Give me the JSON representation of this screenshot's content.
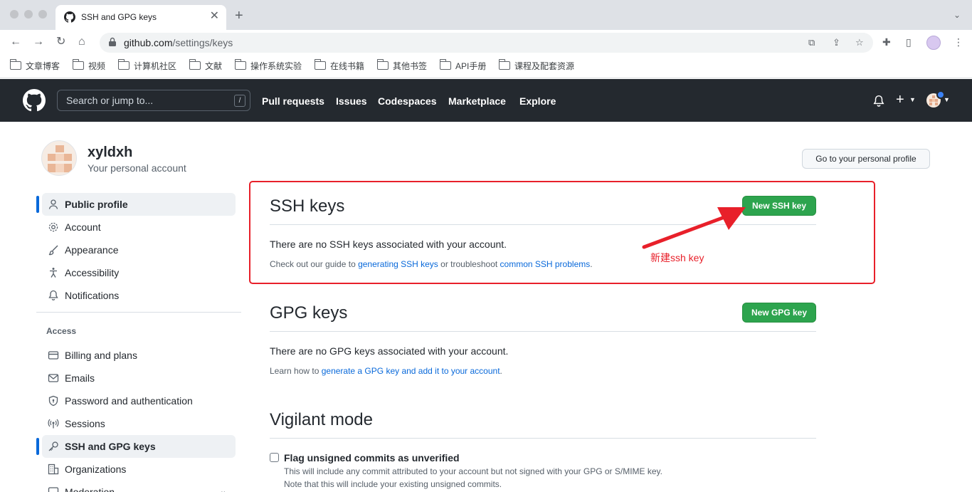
{
  "browser": {
    "tab_title": "SSH and GPG keys",
    "url_host": "github.com",
    "url_path": "/settings/keys",
    "bookmarks": [
      "文章博客",
      "视频",
      "计算机社区",
      "文献",
      "操作系统实验",
      "在线书籍",
      "其他书签",
      "API手册",
      "课程及配套资源"
    ]
  },
  "gh_header": {
    "search_placeholder": "Search or jump to...",
    "slash_key": "/",
    "nav": [
      "Pull requests",
      "Issues",
      "Codespaces",
      "Marketplace",
      "Explore"
    ]
  },
  "profile": {
    "username": "xyldxh",
    "subtitle": "Your personal account",
    "go_profile_label": "Go to your personal profile"
  },
  "sidebar": {
    "top_items": [
      {
        "label": "Public profile",
        "icon": "person-icon",
        "active": true
      },
      {
        "label": "Account",
        "icon": "gear-icon"
      },
      {
        "label": "Appearance",
        "icon": "paintbrush-icon"
      },
      {
        "label": "Accessibility",
        "icon": "accessibility-icon"
      },
      {
        "label": "Notifications",
        "icon": "bell-icon"
      }
    ],
    "access_heading": "Access",
    "access_items": [
      {
        "label": "Billing and plans",
        "icon": "credit-card-icon"
      },
      {
        "label": "Emails",
        "icon": "mail-icon"
      },
      {
        "label": "Password and authentication",
        "icon": "shield-lock-icon"
      },
      {
        "label": "Sessions",
        "icon": "broadcast-icon"
      },
      {
        "label": "SSH and GPG keys",
        "icon": "key-icon",
        "active": true
      },
      {
        "label": "Organizations",
        "icon": "organization-icon"
      },
      {
        "label": "Moderation",
        "icon": "report-icon"
      }
    ]
  },
  "ssh": {
    "title": "SSH keys",
    "new_button": "New SSH key",
    "empty_text": "There are no SSH keys associated with your account.",
    "guide_prefix": "Check out our guide to ",
    "guide_link1": "generating SSH keys",
    "guide_middle": " or troubleshoot ",
    "guide_link2": "common SSH problems",
    "guide_suffix": "."
  },
  "gpg": {
    "title": "GPG keys",
    "new_button": "New GPG key",
    "empty_text": "There are no GPG keys associated with your account.",
    "learn_prefix": "Learn how to ",
    "learn_link": "generate a GPG key and add it to your account",
    "learn_suffix": "."
  },
  "vigilant": {
    "title": "Vigilant mode",
    "checkbox_label": "Flag unsigned commits as unverified",
    "note1": "This will include any commit attributed to your account but not signed with your GPG or S/MIME key.",
    "note2": "Note that this will include your existing unsigned commits."
  },
  "annotation": {
    "text": "新建ssh key",
    "color": "#e8202a"
  },
  "colors": {
    "header_bg": "#24292f",
    "accent_green": "#2da44e",
    "link_blue": "#0969da",
    "active_bar": "#0969da"
  }
}
